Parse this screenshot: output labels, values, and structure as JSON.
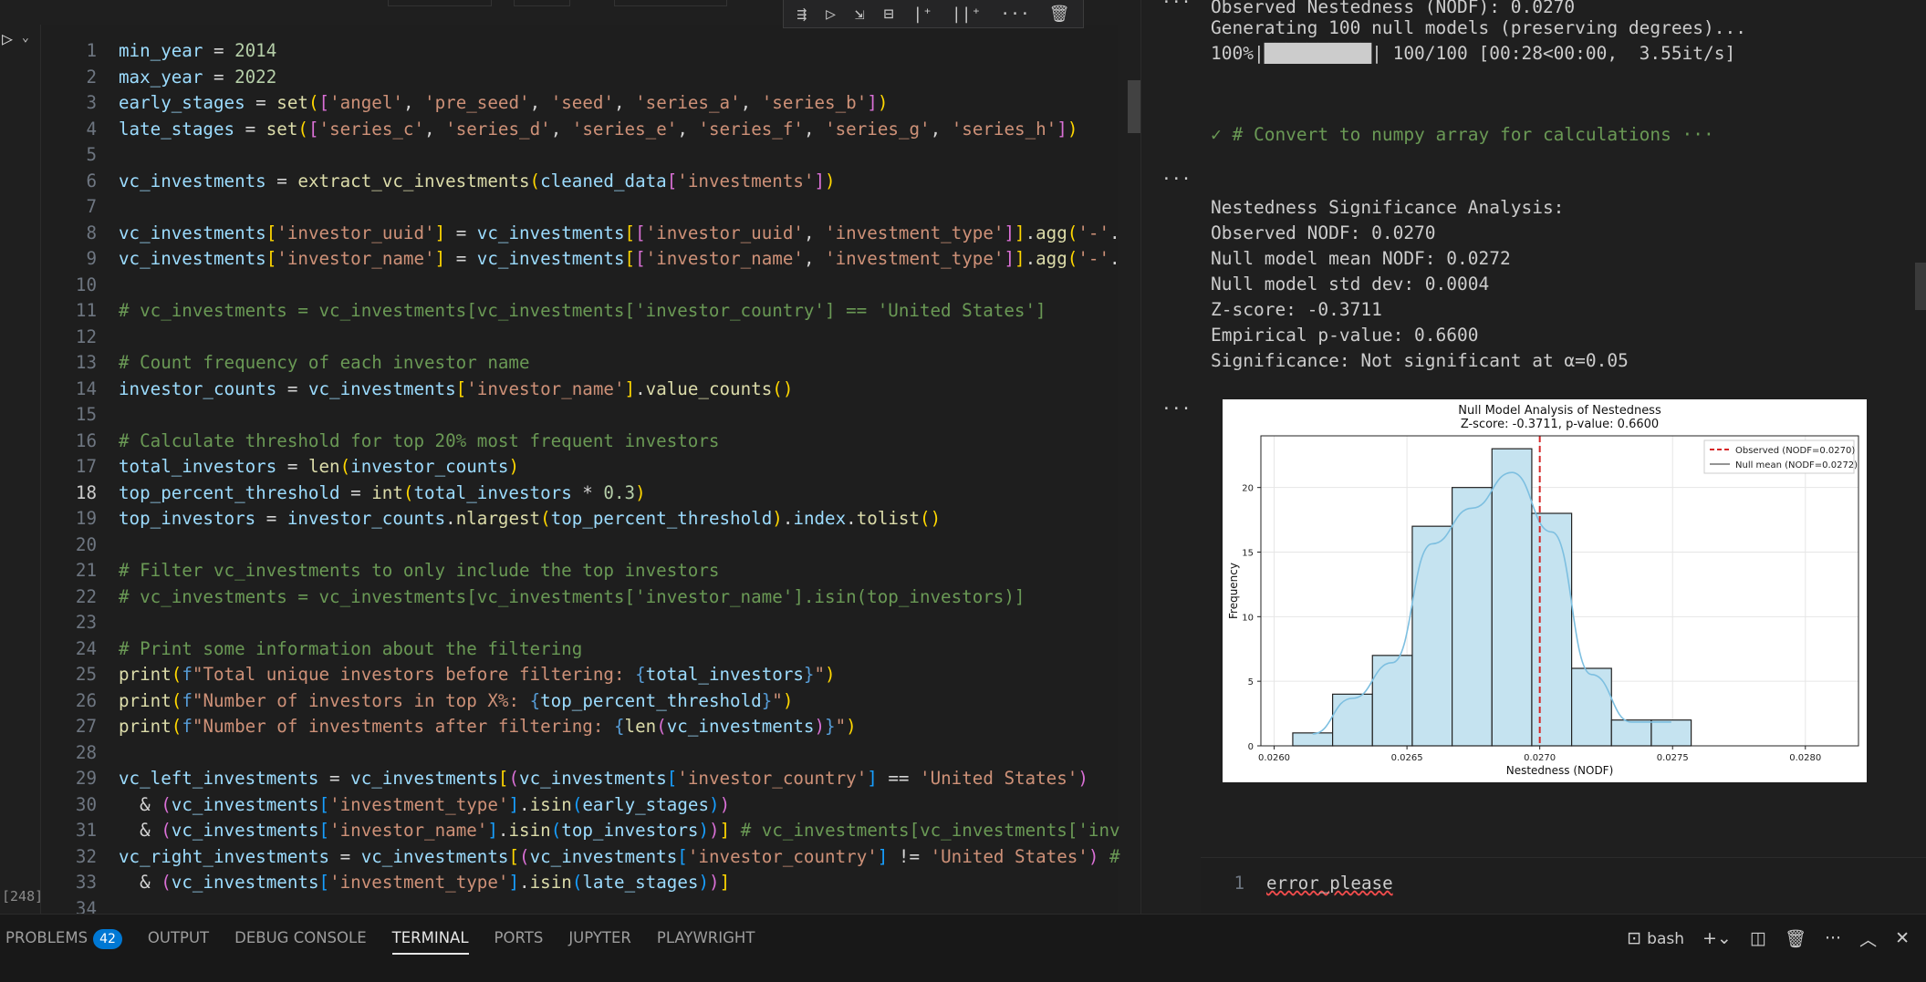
{
  "editor": {
    "execution_count": "[248]",
    "toolbar_icons": [
      "run-by-line-icon",
      "execute-above-icon",
      "execute-below-icon",
      "split-cell-icon",
      "add-markdown-icon",
      "add-code-icon",
      "more-icon",
      "delete-icon"
    ],
    "lines": [
      {
        "n": "1",
        "t": [
          [
            "k",
            "min_year"
          ],
          [
            "p",
            " = "
          ],
          [
            "n",
            "2014"
          ]
        ]
      },
      {
        "n": "2",
        "t": [
          [
            "k",
            "max_year"
          ],
          [
            "p",
            " = "
          ],
          [
            "n",
            "2022"
          ]
        ]
      },
      {
        "n": "3",
        "t": [
          [
            "k",
            "early_stages"
          ],
          [
            "p",
            " = "
          ],
          [
            "f",
            "set"
          ],
          [
            "y",
            "("
          ],
          [
            "m",
            "["
          ],
          [
            "s",
            "'angel'"
          ],
          [
            "p",
            ", "
          ],
          [
            "s",
            "'pre_seed'"
          ],
          [
            "p",
            ", "
          ],
          [
            "s",
            "'seed'"
          ],
          [
            "p",
            ", "
          ],
          [
            "s",
            "'series_a'"
          ],
          [
            "p",
            ", "
          ],
          [
            "s",
            "'series_b'"
          ],
          [
            "m",
            "]"
          ],
          [
            "y",
            ")"
          ]
        ]
      },
      {
        "n": "4",
        "t": [
          [
            "k",
            "late_stages"
          ],
          [
            "p",
            " = "
          ],
          [
            "f",
            "set"
          ],
          [
            "y",
            "("
          ],
          [
            "m",
            "["
          ],
          [
            "s",
            "'series_c'"
          ],
          [
            "p",
            ", "
          ],
          [
            "s",
            "'series_d'"
          ],
          [
            "p",
            ", "
          ],
          [
            "s",
            "'series_e'"
          ],
          [
            "p",
            ", "
          ],
          [
            "s",
            "'series_f'"
          ],
          [
            "p",
            ", "
          ],
          [
            "s",
            "'series_g'"
          ],
          [
            "p",
            ", "
          ],
          [
            "s",
            "'series_h'"
          ],
          [
            "m",
            "]"
          ],
          [
            "y",
            ")"
          ]
        ]
      },
      {
        "n": "5",
        "t": []
      },
      {
        "n": "6",
        "t": [
          [
            "k",
            "vc_investments"
          ],
          [
            "p",
            " = "
          ],
          [
            "f",
            "extract_vc_investments"
          ],
          [
            "y",
            "("
          ],
          [
            "k",
            "cleaned_data"
          ],
          [
            "m",
            "["
          ],
          [
            "s",
            "'investments'"
          ],
          [
            "m",
            "]"
          ],
          [
            "y",
            ")"
          ]
        ]
      },
      {
        "n": "7",
        "t": []
      },
      {
        "n": "8",
        "t": [
          [
            "k",
            "vc_investments"
          ],
          [
            "y",
            "["
          ],
          [
            "s",
            "'investor_uuid'"
          ],
          [
            "y",
            "]"
          ],
          [
            "p",
            " = "
          ],
          [
            "k",
            "vc_investments"
          ],
          [
            "y",
            "["
          ],
          [
            "m",
            "["
          ],
          [
            "s",
            "'investor_uuid'"
          ],
          [
            "p",
            ", "
          ],
          [
            "s",
            "'investment_type'"
          ],
          [
            "m",
            "]"
          ],
          [
            "y",
            "]"
          ],
          [
            "p",
            "."
          ],
          [
            "f",
            "agg"
          ],
          [
            "y",
            "("
          ],
          [
            "s",
            "'-'"
          ],
          [
            "p",
            "."
          ]
        ]
      },
      {
        "n": "9",
        "t": [
          [
            "k",
            "vc_investments"
          ],
          [
            "y",
            "["
          ],
          [
            "s",
            "'investor_name'"
          ],
          [
            "y",
            "]"
          ],
          [
            "p",
            " = "
          ],
          [
            "k",
            "vc_investments"
          ],
          [
            "y",
            "["
          ],
          [
            "m",
            "["
          ],
          [
            "s",
            "'investor_name'"
          ],
          [
            "p",
            ", "
          ],
          [
            "s",
            "'investment_type'"
          ],
          [
            "m",
            "]"
          ],
          [
            "y",
            "]"
          ],
          [
            "p",
            "."
          ],
          [
            "f",
            "agg"
          ],
          [
            "y",
            "("
          ],
          [
            "s",
            "'-'"
          ],
          [
            "p",
            "."
          ]
        ]
      },
      {
        "n": "10",
        "t": []
      },
      {
        "n": "11",
        "t": [
          [
            "c",
            "# vc_investments = vc_investments[vc_investments['investor_country'] == 'United States']"
          ]
        ]
      },
      {
        "n": "12",
        "t": []
      },
      {
        "n": "13",
        "t": [
          [
            "c",
            "# Count frequency of each investor name"
          ]
        ]
      },
      {
        "n": "14",
        "t": [
          [
            "k",
            "investor_counts"
          ],
          [
            "p",
            " = "
          ],
          [
            "k",
            "vc_investments"
          ],
          [
            "y",
            "["
          ],
          [
            "s",
            "'investor_name'"
          ],
          [
            "y",
            "]"
          ],
          [
            "p",
            "."
          ],
          [
            "f",
            "value_counts"
          ],
          [
            "y",
            "()"
          ]
        ]
      },
      {
        "n": "15",
        "t": []
      },
      {
        "n": "16",
        "t": [
          [
            "c",
            "# Calculate threshold for top 20% most frequent investors"
          ]
        ]
      },
      {
        "n": "17",
        "t": [
          [
            "k",
            "total_investors"
          ],
          [
            "p",
            " = "
          ],
          [
            "f",
            "len"
          ],
          [
            "y",
            "("
          ],
          [
            "k",
            "investor_counts"
          ],
          [
            "y",
            ")"
          ]
        ]
      },
      {
        "n": "18",
        "t": [
          [
            "k",
            "top_percent_threshold"
          ],
          [
            "p",
            " = "
          ],
          [
            "f",
            "int"
          ],
          [
            "y",
            "("
          ],
          [
            "k",
            "total_investors"
          ],
          [
            "p",
            " * "
          ],
          [
            "n",
            "0.3"
          ],
          [
            "y",
            ")"
          ]
        ]
      },
      {
        "n": "19",
        "t": [
          [
            "k",
            "top_investors"
          ],
          [
            "p",
            " = "
          ],
          [
            "k",
            "investor_counts"
          ],
          [
            "p",
            "."
          ],
          [
            "f",
            "nlargest"
          ],
          [
            "y",
            "("
          ],
          [
            "k",
            "top_percent_threshold"
          ],
          [
            "y",
            ")"
          ],
          [
            "p",
            "."
          ],
          [
            "k",
            "index"
          ],
          [
            "p",
            "."
          ],
          [
            "f",
            "tolist"
          ],
          [
            "y",
            "()"
          ]
        ]
      },
      {
        "n": "20",
        "t": []
      },
      {
        "n": "21",
        "t": [
          [
            "c",
            "# Filter vc_investments to only include the top investors"
          ]
        ]
      },
      {
        "n": "22",
        "t": [
          [
            "c",
            "# vc_investments = vc_investments[vc_investments['investor_name'].isin(top_investors)]"
          ]
        ]
      },
      {
        "n": "23",
        "t": []
      },
      {
        "n": "24",
        "t": [
          [
            "c",
            "# Print some information about the filtering"
          ]
        ]
      },
      {
        "n": "25",
        "t": [
          [
            "f",
            "print"
          ],
          [
            "y",
            "("
          ],
          [
            "kw",
            "f"
          ],
          [
            "s",
            "\"Total unique investors before filtering: "
          ],
          [
            "kw",
            "{"
          ],
          [
            "k",
            "total_investors"
          ],
          [
            "kw",
            "}"
          ],
          [
            "s",
            "\""
          ],
          [
            "y",
            ")"
          ]
        ]
      },
      {
        "n": "26",
        "t": [
          [
            "f",
            "print"
          ],
          [
            "y",
            "("
          ],
          [
            "kw",
            "f"
          ],
          [
            "s",
            "\"Number of investors in top X%: "
          ],
          [
            "kw",
            "{"
          ],
          [
            "k",
            "top_percent_threshold"
          ],
          [
            "kw",
            "}"
          ],
          [
            "s",
            "\""
          ],
          [
            "y",
            ")"
          ]
        ]
      },
      {
        "n": "27",
        "t": [
          [
            "f",
            "print"
          ],
          [
            "y",
            "("
          ],
          [
            "kw",
            "f"
          ],
          [
            "s",
            "\"Number of investments after filtering: "
          ],
          [
            "kw",
            "{"
          ],
          [
            "f",
            "len"
          ],
          [
            "m",
            "("
          ],
          [
            "k",
            "vc_investments"
          ],
          [
            "m",
            ")"
          ],
          [
            "kw",
            "}"
          ],
          [
            "s",
            "\""
          ],
          [
            "y",
            ")"
          ]
        ]
      },
      {
        "n": "28",
        "t": []
      },
      {
        "n": "29",
        "t": [
          [
            "k",
            "vc_left_investments"
          ],
          [
            "p",
            " = "
          ],
          [
            "k",
            "vc_investments"
          ],
          [
            "y",
            "["
          ],
          [
            "m",
            "("
          ],
          [
            "k",
            "vc_investments"
          ],
          [
            "b",
            "["
          ],
          [
            "s",
            "'investor_country'"
          ],
          [
            "b",
            "]"
          ],
          [
            "p",
            " == "
          ],
          [
            "s",
            "'United States'"
          ],
          [
            "m",
            ")"
          ]
        ]
      },
      {
        "n": "30",
        "t": [
          [
            "p",
            "  & "
          ],
          [
            "m",
            "("
          ],
          [
            "k",
            "vc_investments"
          ],
          [
            "b",
            "["
          ],
          [
            "s",
            "'investment_type'"
          ],
          [
            "b",
            "]"
          ],
          [
            "p",
            "."
          ],
          [
            "f",
            "isin"
          ],
          [
            "b",
            "("
          ],
          [
            "k",
            "early_stages"
          ],
          [
            "b",
            ")"
          ],
          [
            "m",
            ")"
          ]
        ]
      },
      {
        "n": "31",
        "t": [
          [
            "p",
            "  & "
          ],
          [
            "m",
            "("
          ],
          [
            "k",
            "vc_investments"
          ],
          [
            "b",
            "["
          ],
          [
            "s",
            "'investor_name'"
          ],
          [
            "b",
            "]"
          ],
          [
            "p",
            "."
          ],
          [
            "f",
            "isin"
          ],
          [
            "b",
            "("
          ],
          [
            "k",
            "top_investors"
          ],
          [
            "b",
            ")"
          ],
          [
            "m",
            ")"
          ],
          [
            "y",
            "]"
          ],
          [
            "c",
            " # vc_investments[vc_investments['inv"
          ]
        ]
      },
      {
        "n": "32",
        "t": [
          [
            "k",
            "vc_right_investments"
          ],
          [
            "p",
            " = "
          ],
          [
            "k",
            "vc_investments"
          ],
          [
            "y",
            "["
          ],
          [
            "m",
            "("
          ],
          [
            "k",
            "vc_investments"
          ],
          [
            "b",
            "["
          ],
          [
            "s",
            "'investor_country'"
          ],
          [
            "b",
            "]"
          ],
          [
            "p",
            " != "
          ],
          [
            "s",
            "'United States'"
          ],
          [
            "m",
            ")"
          ],
          [
            "c",
            " #"
          ]
        ]
      },
      {
        "n": "33",
        "t": [
          [
            "p",
            "  & "
          ],
          [
            "m",
            "("
          ],
          [
            "k",
            "vc_investments"
          ],
          [
            "b",
            "["
          ],
          [
            "s",
            "'investment_type'"
          ],
          [
            "b",
            "]"
          ],
          [
            "p",
            "."
          ],
          [
            "f",
            "isin"
          ],
          [
            "b",
            "("
          ],
          [
            "k",
            "late_stages"
          ],
          [
            "b",
            ")"
          ],
          [
            "m",
            ")"
          ],
          [
            "y",
            "]"
          ]
        ]
      },
      {
        "n": "34",
        "t": []
      }
    ]
  },
  "output": {
    "top_lines": [
      "Observed Nestedness (NODF): 0.0270",
      "Generating 100 null models (preserving degrees)...",
      "100%|██████████| 100/100 [00:28<00:00,  3.55it/s]"
    ],
    "collapsed_cell": "✓ # Convert to numpy array for calculations ···",
    "analysis_lines": [
      "Nestedness Significance Analysis:",
      "Observed NODF: 0.0270",
      "Null model mean NODF: 0.0272",
      "Null model std dev: 0.0004",
      "Z-score: -0.3711",
      "Empirical p-value: 0.6600",
      "Significance: Not significant at α=0.05"
    ],
    "input_cell": {
      "line_number": "1",
      "text": "error_please"
    }
  },
  "chart_data": {
    "type": "bar",
    "title": "Null Model Analysis of Nestedness",
    "subtitle": "Z-score: -0.3711, p-value: 0.6600",
    "xlabel": "Nestedness (NODF)",
    "ylabel": "Frequency",
    "bin_edges": [
      0.02607,
      0.02622,
      0.02637,
      0.02652,
      0.02667,
      0.02682,
      0.02697,
      0.02712,
      0.02727,
      0.02742,
      0.02757,
      0.02772,
      0.02787,
      0.02802,
      0.02817
    ],
    "values": [
      1,
      4,
      7,
      17,
      20,
      23,
      18,
      6,
      2,
      2
    ],
    "xlim": [
      0.02595,
      0.0282
    ],
    "ylim": [
      0,
      24
    ],
    "xticks": [
      "0.0260",
      "0.0265",
      "0.0270",
      "0.0275",
      "0.0280"
    ],
    "xtick_values": [
      0.026,
      0.0265,
      0.027,
      0.0275,
      0.028
    ],
    "yticks": [
      0,
      5,
      10,
      15,
      20
    ],
    "observed": 0.027,
    "legend": [
      "Observed (NODF=0.0270)",
      "Null mean (NODF=0.0272)"
    ],
    "legend_position": "top-right",
    "grid": true,
    "colors": {
      "bars": "#c5e3f0",
      "edge": "#222222",
      "kde": "#7dbfe0",
      "observed": "#d62728"
    }
  },
  "panel": {
    "tabs": [
      {
        "label": "PROBLEMS",
        "badge": "42"
      },
      {
        "label": "OUTPUT"
      },
      {
        "label": "DEBUG CONSOLE"
      },
      {
        "label": "TERMINAL",
        "active": true
      },
      {
        "label": "PORTS"
      },
      {
        "label": "JUPYTER"
      },
      {
        "label": "PLAYWRIGHT"
      }
    ],
    "terminal_shell": "bash"
  }
}
